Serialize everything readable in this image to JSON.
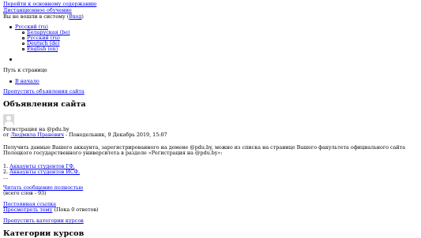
{
  "nav": {
    "skip_main": "Перейти к основному содержанию",
    "site_name": "Дистанционное обучение",
    "login_status_prefix": "Вы не вошли в систему (",
    "login_link": "Вход",
    "login_status_suffix": ")"
  },
  "language_menu": {
    "current": "Русский (ru)",
    "options": [
      "Беларуская (be)",
      "Русский (ru)",
      "Deutsch (de)",
      "English (en)"
    ]
  },
  "breadcrumb": {
    "heading": "Путь к странице",
    "items": [
      "В начало"
    ]
  },
  "announcements": {
    "skip_link": "Пропустить объявления сайта",
    "title": "Объявления сайта",
    "post": {
      "subject": "Регистрация на @pdu.by",
      "by_prefix": "от ",
      "author": "Людмила Праневич",
      "date": " - Понедельник, 9 Декабрь 2019, 15:07",
      "body": "Получить данные Вашего аккаунта, зарегистрированного на домене @pdu.by, можно из списка на странице Вашего факультета официального сайта Полоцкого государственного университета в разделе «Регистрация на @pdu.by»:",
      "list": [
        {
          "num": "1.",
          "label": "Аккаунты студентов ГФ."
        },
        {
          "num": "2.",
          "label": "Аккаунты студентов ИСФ."
        }
      ],
      "ellipsis": "...",
      "read_more": "Читать сообщение полностью",
      "word_count": "(всего слов - 93)",
      "permalink": "Постоянная ссылка",
      "discuss": "Просмотреть тему",
      "replies": " (Пока 0 ответов)"
    }
  },
  "courses": {
    "skip_link": "Пропустить категории курсов",
    "title": "Категории курсов"
  }
}
